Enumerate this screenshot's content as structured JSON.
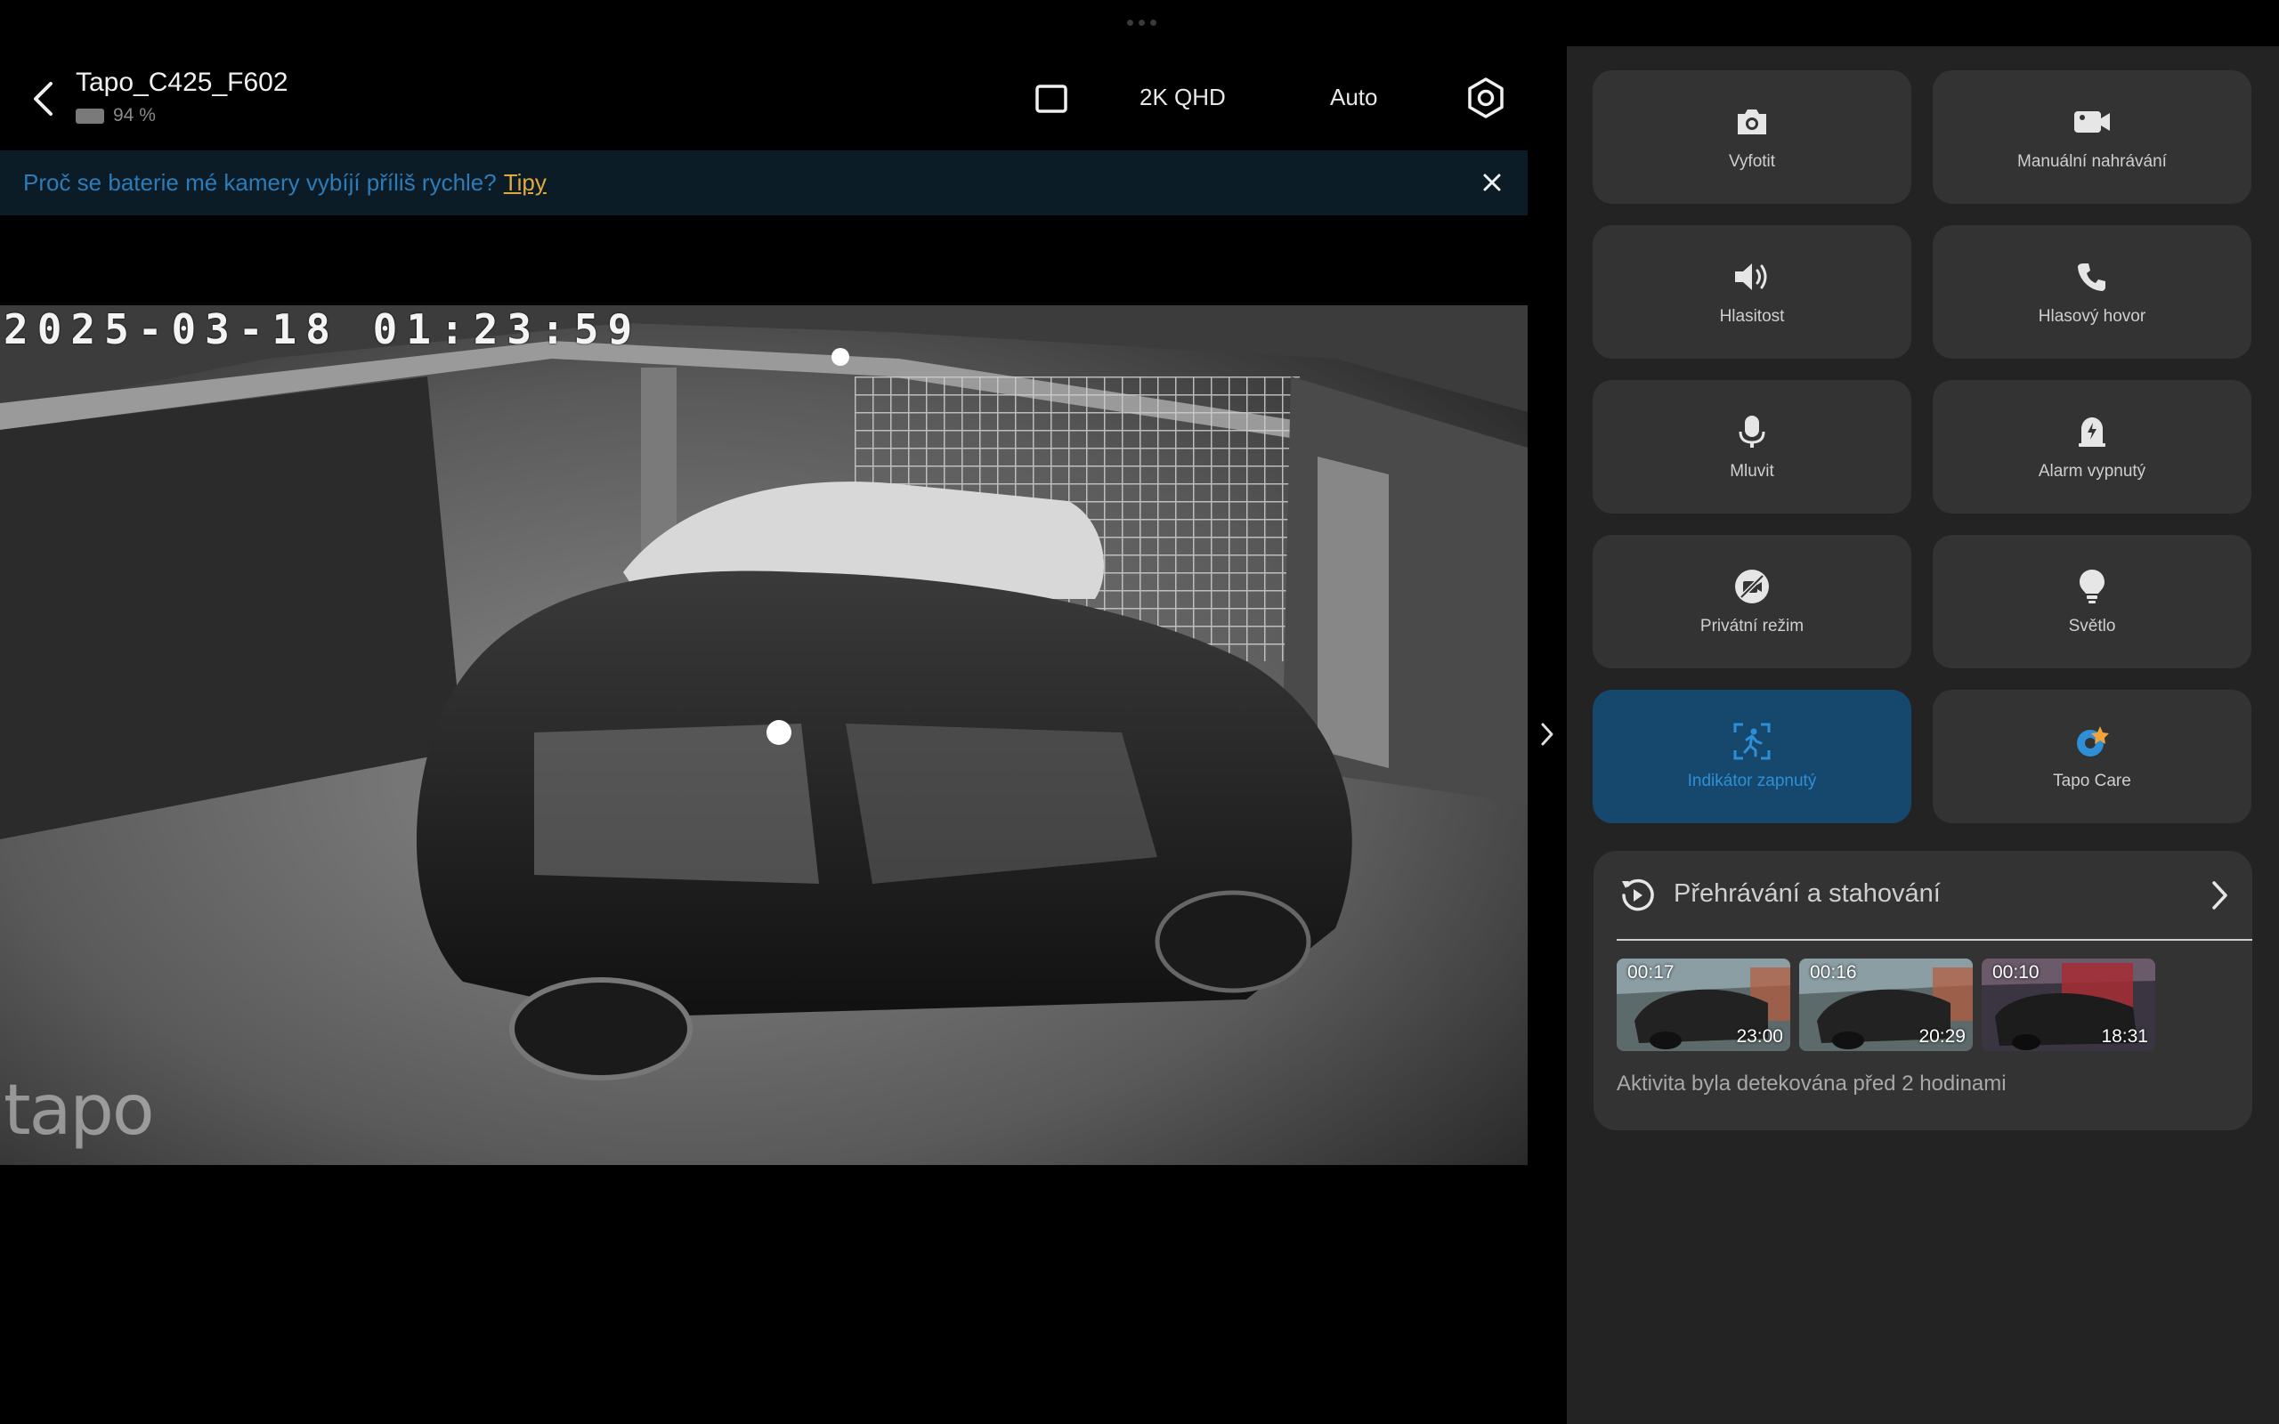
{
  "header": {
    "camera_name": "Tapo_C425_F602",
    "battery": "94 %",
    "quality": "2K QHD",
    "mode": "Auto"
  },
  "banner": {
    "text": "Proč se baterie mé kamery vybíjí příliš rychle?",
    "link": "Tipy"
  },
  "video": {
    "timestamp": "2025-03-18 01:23:59",
    "watermark": "tapo"
  },
  "controls": [
    {
      "label": "Vyfotit",
      "icon": "camera-icon"
    },
    {
      "label": "Manuální nahrávání",
      "icon": "video-record-icon"
    },
    {
      "label": "Hlasitost",
      "icon": "speaker-icon"
    },
    {
      "label": "Hlasový hovor",
      "icon": "phone-icon"
    },
    {
      "label": "Mluvit",
      "icon": "microphone-icon"
    },
    {
      "label": "Alarm vypnutý",
      "icon": "alarm-icon"
    },
    {
      "label": "Privátní režim",
      "icon": "privacy-icon"
    },
    {
      "label": "Světlo",
      "icon": "bulb-icon"
    },
    {
      "label": "Indikátor zapnutý",
      "icon": "motion-indicator-icon",
      "active": true
    },
    {
      "label": "Tapo Care",
      "icon": "tapo-care-icon"
    }
  ],
  "playback": {
    "title": "Přehrávání a stahování",
    "clips": [
      {
        "duration": "00:17",
        "time": "23:00"
      },
      {
        "duration": "00:16",
        "time": "20:29"
      },
      {
        "duration": "00:10",
        "time": "18:31"
      }
    ],
    "activity": "Aktivita byla detekována před 2 hodinami"
  },
  "colors": {
    "accent": "#2f8fd6",
    "active_tile": "#16486d",
    "banner_bg": "#0b1c27",
    "link": "#e0a93f",
    "tile_bg": "#333333",
    "panel_bg": "#232323"
  }
}
